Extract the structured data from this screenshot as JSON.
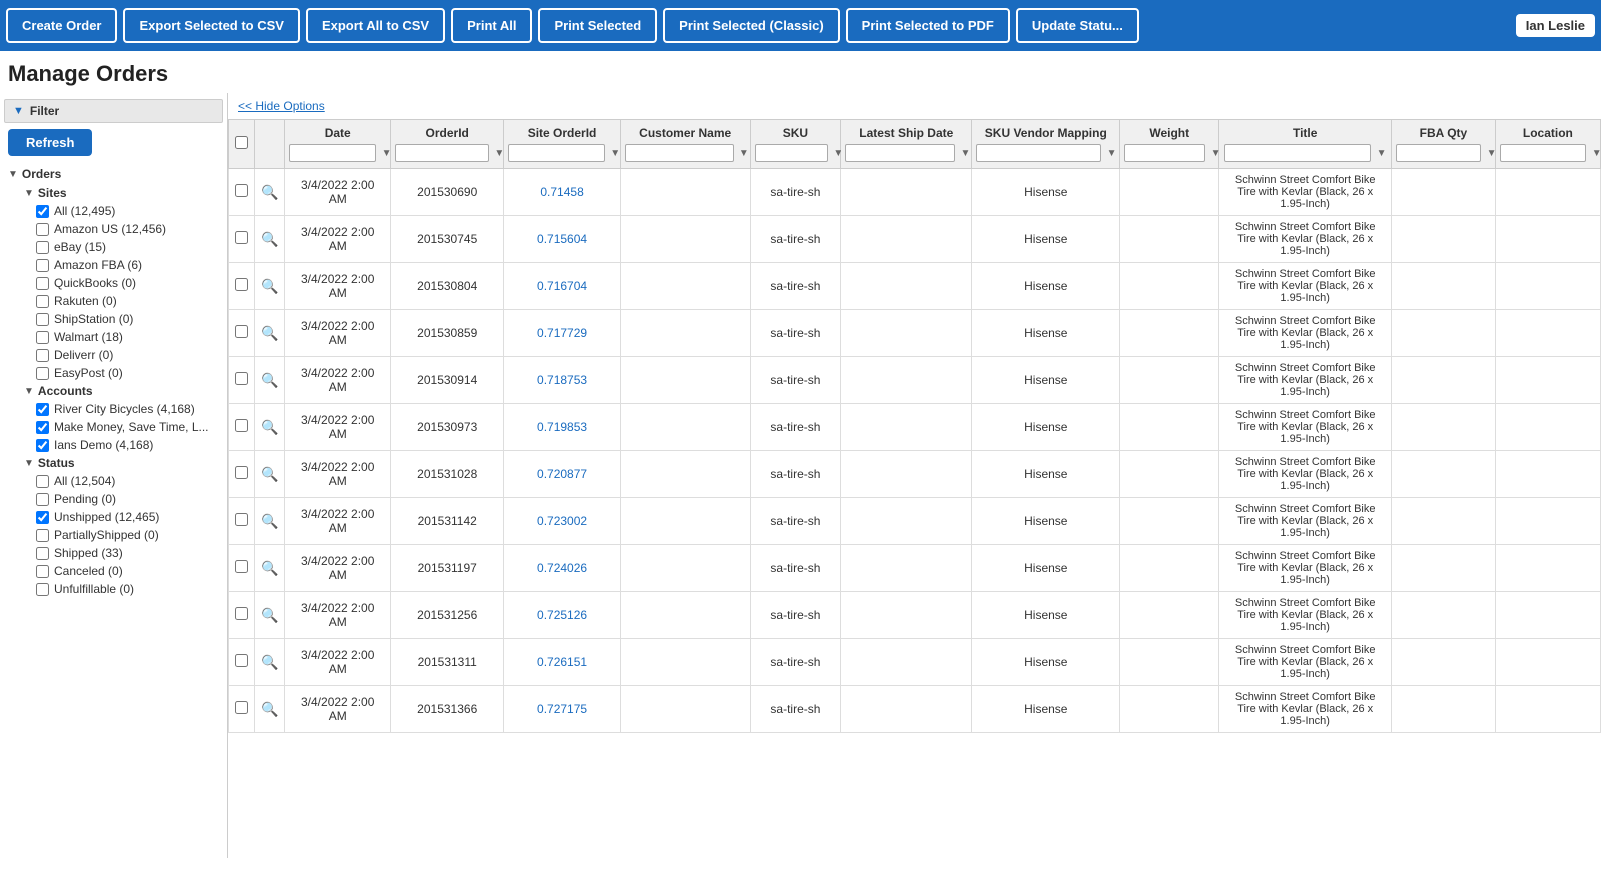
{
  "toolbar": {
    "buttons": [
      {
        "id": "create-order",
        "label": "Create Order"
      },
      {
        "id": "export-selected-csv",
        "label": "Export Selected to CSV"
      },
      {
        "id": "export-all-csv",
        "label": "Export All to CSV"
      },
      {
        "id": "print-all",
        "label": "Print All"
      },
      {
        "id": "print-selected",
        "label": "Print Selected"
      },
      {
        "id": "print-selected-classic",
        "label": "Print Selected (Classic)"
      },
      {
        "id": "print-selected-pdf",
        "label": "Print Selected to PDF"
      },
      {
        "id": "update-status",
        "label": "Update Statu..."
      }
    ],
    "user": "Ian Leslie"
  },
  "page": {
    "title": "Manage Orders",
    "hide_options_label": "<< Hide Options"
  },
  "sidebar": {
    "filter_label": "Filter",
    "refresh_label": "Refresh",
    "sections": [
      {
        "label": "Orders",
        "subsections": [
          {
            "label": "Sites",
            "items": [
              {
                "label": "All (12,495)",
                "checked": true
              },
              {
                "label": "Amazon US (12,456)",
                "checked": false
              },
              {
                "label": "eBay (15)",
                "checked": false
              },
              {
                "label": "Amazon FBA (6)",
                "checked": false
              },
              {
                "label": "QuickBooks (0)",
                "checked": false
              },
              {
                "label": "Rakuten (0)",
                "checked": false
              },
              {
                "label": "ShipStation (0)",
                "checked": false
              },
              {
                "label": "Walmart (18)",
                "checked": false
              },
              {
                "label": "Deliverr (0)",
                "checked": false
              },
              {
                "label": "EasyPost (0)",
                "checked": false
              }
            ]
          },
          {
            "label": "Accounts",
            "items": [
              {
                "label": "River City Bicycles (4,168)",
                "checked": true
              },
              {
                "label": "Make Money, Save Time, L...",
                "checked": true
              },
              {
                "label": "Ians Demo (4,168)",
                "checked": true
              }
            ]
          },
          {
            "label": "Status",
            "items": [
              {
                "label": "All (12,504)",
                "checked": false
              },
              {
                "label": "Pending (0)",
                "checked": false
              },
              {
                "label": "Unshipped (12,465)",
                "checked": true
              },
              {
                "label": "PartiallyShipped (0)",
                "checked": false
              },
              {
                "label": "Shipped (33)",
                "checked": false
              },
              {
                "label": "Canceled (0)",
                "checked": false
              },
              {
                "label": "Unfulfillable (0)",
                "checked": false
              }
            ]
          }
        ]
      }
    ]
  },
  "table": {
    "columns": [
      {
        "id": "checkbox",
        "label": ""
      },
      {
        "id": "search",
        "label": ""
      },
      {
        "id": "date",
        "label": "Date"
      },
      {
        "id": "orderid",
        "label": "OrderId"
      },
      {
        "id": "siteorderid",
        "label": "Site OrderId"
      },
      {
        "id": "customername",
        "label": "Customer Name"
      },
      {
        "id": "sku",
        "label": "SKU"
      },
      {
        "id": "latestship",
        "label": "Latest Ship Date"
      },
      {
        "id": "skuvendor",
        "label": "SKU Vendor Mapping"
      },
      {
        "id": "weight",
        "label": "Weight"
      },
      {
        "id": "title",
        "label": "Title"
      },
      {
        "id": "fbaqty",
        "label": "FBA Qty"
      },
      {
        "id": "location",
        "label": "Location"
      }
    ],
    "rows": [
      {
        "date": "3/4/2022 2:00 AM",
        "orderid": "201530690",
        "siteorderid": "0.71458",
        "customername": "",
        "sku": "sa-tire-sh",
        "latestship": "",
        "skuvendor": "Hisense",
        "weight": "",
        "title": "Schwinn Street Comfort Bike Tire with Kevlar (Black, 26 x 1.95-Inch)",
        "fbaqty": "",
        "location": ""
      },
      {
        "date": "3/4/2022 2:00 AM",
        "orderid": "201530745",
        "siteorderid": "0.715604",
        "customername": "",
        "sku": "sa-tire-sh",
        "latestship": "",
        "skuvendor": "Hisense",
        "weight": "",
        "title": "Schwinn Street Comfort Bike Tire with Kevlar (Black, 26 x 1.95-Inch)",
        "fbaqty": "",
        "location": ""
      },
      {
        "date": "3/4/2022 2:00 AM",
        "orderid": "201530804",
        "siteorderid": "0.716704",
        "customername": "",
        "sku": "sa-tire-sh",
        "latestship": "",
        "skuvendor": "Hisense",
        "weight": "",
        "title": "Schwinn Street Comfort Bike Tire with Kevlar (Black, 26 x 1.95-Inch)",
        "fbaqty": "",
        "location": ""
      },
      {
        "date": "3/4/2022 2:00 AM",
        "orderid": "201530859",
        "siteorderid": "0.717729",
        "customername": "",
        "sku": "sa-tire-sh",
        "latestship": "",
        "skuvendor": "Hisense",
        "weight": "",
        "title": "Schwinn Street Comfort Bike Tire with Kevlar (Black, 26 x 1.95-Inch)",
        "fbaqty": "",
        "location": ""
      },
      {
        "date": "3/4/2022 2:00 AM",
        "orderid": "201530914",
        "siteorderid": "0.718753",
        "customername": "",
        "sku": "sa-tire-sh",
        "latestship": "",
        "skuvendor": "Hisense",
        "weight": "",
        "title": "Schwinn Street Comfort Bike Tire with Kevlar (Black, 26 x 1.95-Inch)",
        "fbaqty": "",
        "location": ""
      },
      {
        "date": "3/4/2022 2:00 AM",
        "orderid": "201530973",
        "siteorderid": "0.719853",
        "customername": "",
        "sku": "sa-tire-sh",
        "latestship": "",
        "skuvendor": "Hisense",
        "weight": "",
        "title": "Schwinn Street Comfort Bike Tire with Kevlar (Black, 26 x 1.95-Inch)",
        "fbaqty": "",
        "location": ""
      },
      {
        "date": "3/4/2022 2:00 AM",
        "orderid": "201531028",
        "siteorderid": "0.720877",
        "customername": "",
        "sku": "sa-tire-sh",
        "latestship": "",
        "skuvendor": "Hisense",
        "weight": "",
        "title": "Schwinn Street Comfort Bike Tire with Kevlar (Black, 26 x 1.95-Inch)",
        "fbaqty": "",
        "location": ""
      },
      {
        "date": "3/4/2022 2:00 AM",
        "orderid": "201531142",
        "siteorderid": "0.723002",
        "customername": "",
        "sku": "sa-tire-sh",
        "latestship": "",
        "skuvendor": "Hisense",
        "weight": "",
        "title": "Schwinn Street Comfort Bike Tire with Kevlar (Black, 26 x 1.95-Inch)",
        "fbaqty": "",
        "location": ""
      },
      {
        "date": "3/4/2022 2:00 AM",
        "orderid": "201531197",
        "siteorderid": "0.724026",
        "customername": "",
        "sku": "sa-tire-sh",
        "latestship": "",
        "skuvendor": "Hisense",
        "weight": "",
        "title": "Schwinn Street Comfort Bike Tire with Kevlar (Black, 26 x 1.95-Inch)",
        "fbaqty": "",
        "location": ""
      },
      {
        "date": "3/4/2022 2:00 AM",
        "orderid": "201531256",
        "siteorderid": "0.725126",
        "customername": "",
        "sku": "sa-tire-sh",
        "latestship": "",
        "skuvendor": "Hisense",
        "weight": "",
        "title": "Schwinn Street Comfort Bike Tire with Kevlar (Black, 26 x 1.95-Inch)",
        "fbaqty": "",
        "location": ""
      },
      {
        "date": "3/4/2022 2:00 AM",
        "orderid": "201531311",
        "siteorderid": "0.726151",
        "customername": "",
        "sku": "sa-tire-sh",
        "latestship": "",
        "skuvendor": "Hisense",
        "weight": "",
        "title": "Schwinn Street Comfort Bike Tire with Kevlar (Black, 26 x 1.95-Inch)",
        "fbaqty": "",
        "location": ""
      },
      {
        "date": "3/4/2022 2:00 AM",
        "orderid": "201531366",
        "siteorderid": "0.727175",
        "customername": "",
        "sku": "sa-tire-sh",
        "latestship": "",
        "skuvendor": "Hisense",
        "weight": "",
        "title": "Schwinn Street Comfort Bike Tire with Kevlar (Black, 26 x 1.95-Inch)",
        "fbaqty": "",
        "location": ""
      }
    ]
  }
}
